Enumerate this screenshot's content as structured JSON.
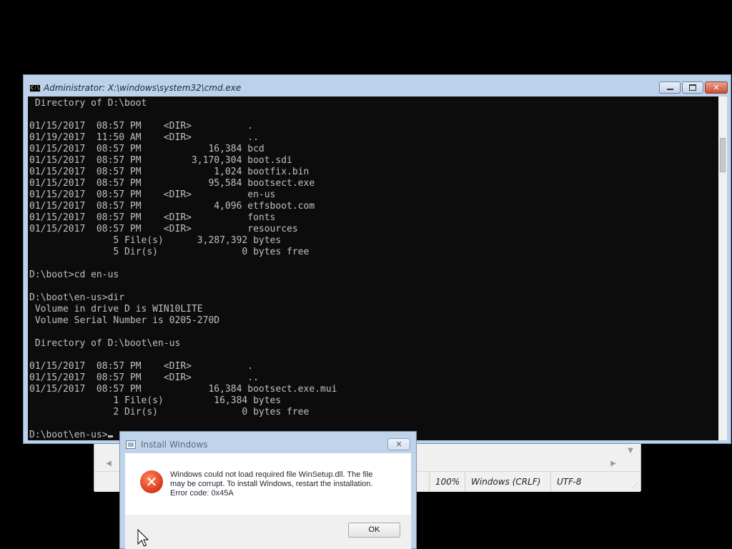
{
  "notepad": {
    "zoom": "100%",
    "line_ending": "Windows (CRLF)",
    "encoding": "UTF-8",
    "scroll_left_icon": "left-arrow-icon",
    "scroll_right_icon": "right-arrow-icon",
    "scroll_down_icon": "down-arrow-icon"
  },
  "cmd": {
    "title": "Administrator: X:\\windows\\system32\\cmd.exe",
    "icon": "C:\\",
    "close_glyph": "✕",
    "lines": [
      " Directory of D:\\boot",
      "",
      "01/15/2017  08:57 PM    <DIR>          .",
      "01/19/2017  11:50 AM    <DIR>          ..",
      "01/15/2017  08:57 PM            16,384 bcd",
      "01/15/2017  08:57 PM         3,170,304 boot.sdi",
      "01/15/2017  08:57 PM             1,024 bootfix.bin",
      "01/15/2017  08:57 PM            95,584 bootsect.exe",
      "01/15/2017  08:57 PM    <DIR>          en-us",
      "01/15/2017  08:57 PM             4,096 etfsboot.com",
      "01/15/2017  08:57 PM    <DIR>          fonts",
      "01/15/2017  08:57 PM    <DIR>          resources",
      "               5 File(s)      3,287,392 bytes",
      "               5 Dir(s)               0 bytes free",
      "",
      "D:\\boot>cd en-us",
      "",
      "D:\\boot\\en-us>dir",
      " Volume in drive D is WIN10LITE",
      " Volume Serial Number is 0205-270D",
      "",
      " Directory of D:\\boot\\en-us",
      "",
      "01/15/2017  08:57 PM    <DIR>          .",
      "01/15/2017  08:57 PM    <DIR>          ..",
      "01/15/2017  08:57 PM            16,384 bootsect.exe.mui",
      "               1 File(s)         16,384 bytes",
      "               2 Dir(s)               0 bytes free",
      "",
      "D:\\boot\\en-us>"
    ]
  },
  "dialog": {
    "title": "Install Windows",
    "close_glyph": "✕",
    "error_glyph": "✕",
    "message_lines": [
      "Windows could not load required file WinSetup.dll. The file",
      "may be corrupt. To install Windows, restart the installation.",
      "Error code: 0x45A"
    ],
    "ok_label": "OK"
  },
  "colors": {
    "console_bg": "#0c0c0c",
    "console_fg": "#c0c0c0",
    "window_frame": "#bcd1ea",
    "close_red": "#c94d33",
    "error_icon": "#d9361b"
  }
}
